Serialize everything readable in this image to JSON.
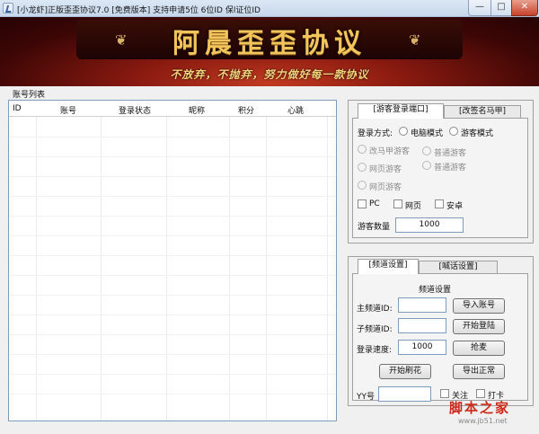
{
  "window": {
    "title": "[小龙虾]正版歪歪协议7.0 [免费版本] 支持申请5位 6位ID 保l证位ID",
    "minimize_glyph": "—",
    "maximize_glyph": "□",
    "close_glyph": "✕"
  },
  "banner": {
    "headline": "阿晨歪歪协议",
    "slogan": "不放弃，不抛弃，努力做好每一款协议",
    "ornament_left": "❦",
    "ornament_right": "❦"
  },
  "account_list": {
    "label": "账号列表",
    "columns": [
      "ID",
      "账号",
      "登录状态",
      "昵称",
      "积分",
      "心跳"
    ]
  },
  "guest_panel": {
    "tabs": [
      "[游客登录端口]",
      "[改签名马甲]"
    ],
    "login_mode_label": "登录方式:",
    "login_modes": [
      "电脑模式",
      "游客模式"
    ],
    "disabled_options": [
      "改马甲游客",
      "普通游客",
      "网页游客",
      "普通游客",
      "网页游客"
    ],
    "platforms": [
      "PC",
      "网页",
      "安卓"
    ],
    "guest_count_label": "游客数量",
    "guest_count": "1000"
  },
  "channel_panel": {
    "tabs": [
      "[频道设置]",
      "[喊话设置]"
    ],
    "section_title": "频道设置",
    "main_channel_label": "主频道ID:",
    "main_channel_value": "",
    "sub_channel_label": "子频道ID:",
    "sub_channel_value": "",
    "speed_label": "登录速度:",
    "speed_value": "1000",
    "buttons": {
      "import": "导入账号",
      "start_login": "开始登陆",
      "grab": "抢麦",
      "start_flower": "开始刷花",
      "export": "导出正常"
    },
    "yy_label": "YY号",
    "yy_value": "",
    "follow_label": "关注",
    "checkin_label": "打卡"
  },
  "watermark": {
    "text": "脚本之家",
    "url": "www.jb51.net"
  },
  "colors": {
    "banner_gold": "#f1c55b",
    "banner_red": "#8a1a10",
    "watermark_red": "#cc2a1a"
  }
}
